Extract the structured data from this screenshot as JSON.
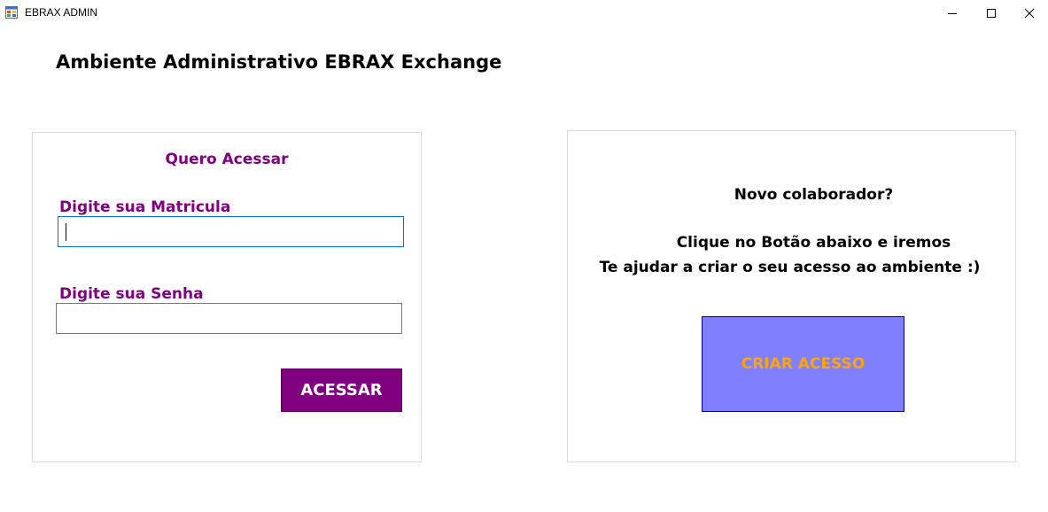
{
  "window": {
    "title": "EBRAX ADMIN",
    "icon": "app-window-icon",
    "controls": {
      "minimize": "minimize-icon",
      "maximize": "maximize-icon",
      "close": "close-icon"
    }
  },
  "heading": "Ambiente Administrativo EBRAX Exchange",
  "login": {
    "title": "Quero Acessar",
    "matricula_label": "Digite sua Matricula",
    "matricula_value": "",
    "senha_label": "Digite sua Senha",
    "senha_value": "",
    "button_label": "ACESSAR"
  },
  "new_user": {
    "question": "Novo colaborador?",
    "line1": "Clique no Botão abaixo e iremos",
    "line2": "Te ajudar a criar o seu acesso ao ambiente :)",
    "button_label": "CRIAR ACESSO"
  },
  "colors": {
    "label_purple": "#800080",
    "acessar_bg": "#800080",
    "acessar_text": "#ffffff",
    "criar_bg": "#8080ff",
    "criar_border": "#00008b",
    "criar_text": "#ffa500",
    "input_focus_border": "#0078d7"
  }
}
